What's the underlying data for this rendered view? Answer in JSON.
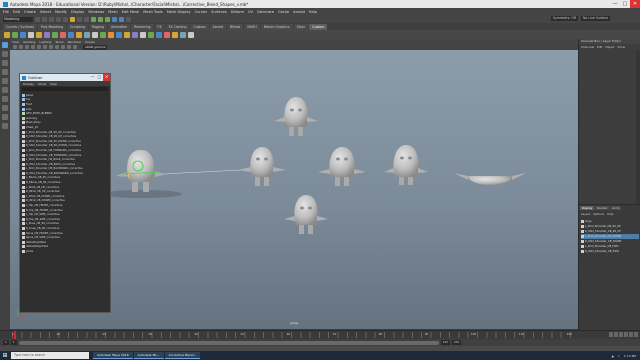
{
  "window": {
    "title": "Autodesk Maya 2018 - Educational Version: D:\\Ruby\\Misha\\..\\Character\\Facial\\Misha\\...\\Corrective_Blend_Shapes_v.mb*",
    "controls": [
      "—",
      "□",
      "✕"
    ]
  },
  "menubar": {
    "items": [
      "File",
      "Edit",
      "Create",
      "Select",
      "Modify",
      "Display",
      "Windows",
      "Mesh",
      "Edit Mesh",
      "Mesh Tools",
      "Mesh Display",
      "Curves",
      "Surfaces",
      "Deform",
      "UV",
      "Generate",
      "Cache",
      "Arnold",
      "Help"
    ]
  },
  "statusline": {
    "mode": "Modeling",
    "symmetry": "Symmetry: Off",
    "live": "No Live Surface"
  },
  "shelf": {
    "tabs": [
      "Curves / Surfaces",
      "Poly Modeling",
      "Sculpting",
      "Rigging",
      "Animation",
      "Rendering",
      "FX",
      "FX Caching",
      "Custom",
      "Arnold",
      "Bifrost",
      "MASH",
      "Motion Graphics",
      "XGen",
      "Custom"
    ],
    "active_tab": "Custom",
    "icon_colors": [
      "#d7a534",
      "#6aa84f",
      "#4a86c6",
      "#c9c9c9",
      "#d7a534",
      "#8e7cc3",
      "#6aa84f",
      "#e06666",
      "#4a86c6",
      "#d7a534",
      "#76a5af",
      "#c9c9c9",
      "#6aa84f",
      "#e69138",
      "#4a86c6",
      "#d7a534",
      "#8e7cc3",
      "#c9c9c9",
      "#6aa84f",
      "#4a86c6",
      "#e06666",
      "#d7a534",
      "#76a5af",
      "#c9c9c9"
    ]
  },
  "viewport": {
    "panel_menu": [
      "View",
      "Shading",
      "Lighting",
      "Show",
      "Renderer",
      "Panels"
    ],
    "colorspace": "sRGB gamma",
    "camera": "persp"
  },
  "outliner": {
    "title": "Outliner",
    "menu": [
      "Display",
      "Show",
      "Help"
    ],
    "rows": [
      {
        "label": "persp",
        "color": "#9fc5e8"
      },
      {
        "label": "top",
        "color": "#9fc5e8"
      },
      {
        "label": "front",
        "color": "#9fc5e8"
      },
      {
        "label": "side",
        "color": "#9fc5e8"
      },
      {
        "label": "GEO_BODY_BLENDS",
        "color": "#b6d7a8"
      },
      {
        "label": "skinning",
        "color": "#b6d7a8"
      },
      {
        "label": "Mesh_Body",
        "color": "#cfcfcf"
      },
      {
        "label": "Chest_Jnt",
        "color": "#cfcfcf"
      },
      {
        "label": "L_Shld_Shoulder_CB_90_UP_corrective",
        "color": "#cfcfcf"
      },
      {
        "label": "R_Shld_Shoulder_CB_90_UP_corrective",
        "color": "#cfcfcf"
      },
      {
        "label": "L_Shld_Shoulder_CB_90_DOWN_corrective",
        "color": "#cfcfcf"
      },
      {
        "label": "R_Shld_Shoulder_CB_90_DOWN_corrective",
        "color": "#cfcfcf"
      },
      {
        "label": "L_Shld_Shoulder_CB_FORWARD_corrective",
        "color": "#cfcfcf"
      },
      {
        "label": "R_Shld_Shoulder_CB_FORWARD_corrective",
        "color": "#cfcfcf"
      },
      {
        "label": "L_Shld_Shoulder_CB_BACK_corrective",
        "color": "#cfcfcf"
      },
      {
        "label": "R_Shld_Shoulder_CB_BACK_corrective",
        "color": "#cfcfcf"
      },
      {
        "label": "L_Shld_Shoulder_CB_BACKWARD_corrective",
        "color": "#cfcfcf"
      },
      {
        "label": "R_Shld_Shoulder_CB_BACKWARD_corrective",
        "color": "#cfcfcf"
      },
      {
        "label": "L_Elbow_CB_90_corrective",
        "color": "#cfcfcf"
      },
      {
        "label": "R_Elbow_CB_90_corrective",
        "color": "#cfcfcf"
      },
      {
        "label": "L_Wrist_CB_UP_corrective",
        "color": "#cfcfcf"
      },
      {
        "label": "R_Wrist_CB_UP_corrective",
        "color": "#cfcfcf"
      },
      {
        "label": "L_Wrist_CB_DOWN_corrective",
        "color": "#cfcfcf"
      },
      {
        "label": "R_Wrist_CB_DOWN_corrective",
        "color": "#cfcfcf"
      },
      {
        "label": "L_Hip_CB_FRONT_corrective",
        "color": "#cfcfcf"
      },
      {
        "label": "R_Hip_CB_FRONT_corrective",
        "color": "#cfcfcf"
      },
      {
        "label": "L_Hip_CB_SIDE_corrective",
        "color": "#cfcfcf"
      },
      {
        "label": "R_Hip_CB_SIDE_corrective",
        "color": "#cfcfcf"
      },
      {
        "label": "L_Knee_CB_90_corrective",
        "color": "#cfcfcf"
      },
      {
        "label": "R_Knee_CB_90_corrective",
        "color": "#cfcfcf"
      },
      {
        "label": "Spine_CB_FRONT_corrective",
        "color": "#cfcfcf"
      },
      {
        "label": "Spine_CB_SIDE_corrective",
        "color": "#cfcfcf"
      },
      {
        "label": "defaultLightSet",
        "color": "#cfcfcf"
      },
      {
        "label": "defaultObjectSet",
        "color": "#cfcfcf"
      },
      {
        "label": "joints",
        "color": "#cfcfcf"
      }
    ]
  },
  "channelbox": {
    "header": "Channel Box / Layer Editor",
    "menu": [
      "Channels",
      "Edit",
      "Object",
      "Show"
    ]
  },
  "layers": {
    "tabs": [
      "Display",
      "Render",
      "Anim"
    ],
    "active_tab": "Display",
    "menu": [
      "Layers",
      "Options",
      "Help"
    ],
    "rows": [
      {
        "label": "Guys"
      },
      {
        "label": "L_Shld_Shoulder_CB_90_UP"
      },
      {
        "label": "R_Shld_Shoulder_CB_90_UP"
      },
      {
        "label": "L_Shld_Shoulder_CB_DOWN"
      },
      {
        "label": "R_Shld_Shoulder_CB_DOWN"
      },
      {
        "label": "L_Shld_Shoulder_CB_FWD"
      },
      {
        "label": "R_Shld_Shoulder_CB_FWD"
      }
    ],
    "selected_row": 3
  },
  "timeslider": {
    "labels": [
      "1",
      "10",
      "20",
      "30",
      "40",
      "50",
      "60",
      "70",
      "80",
      "90",
      "100",
      "110",
      "120"
    ]
  },
  "rangeslider": {
    "start": "1",
    "range_start": "1",
    "range_end": "120",
    "end": "200"
  },
  "taskbar": {
    "search": "Type here to search",
    "tasks": [
      "Autodesk Maya 2018",
      "Autodesk Ms...",
      "Corrective Blend..."
    ],
    "time": "1:13 PM"
  }
}
